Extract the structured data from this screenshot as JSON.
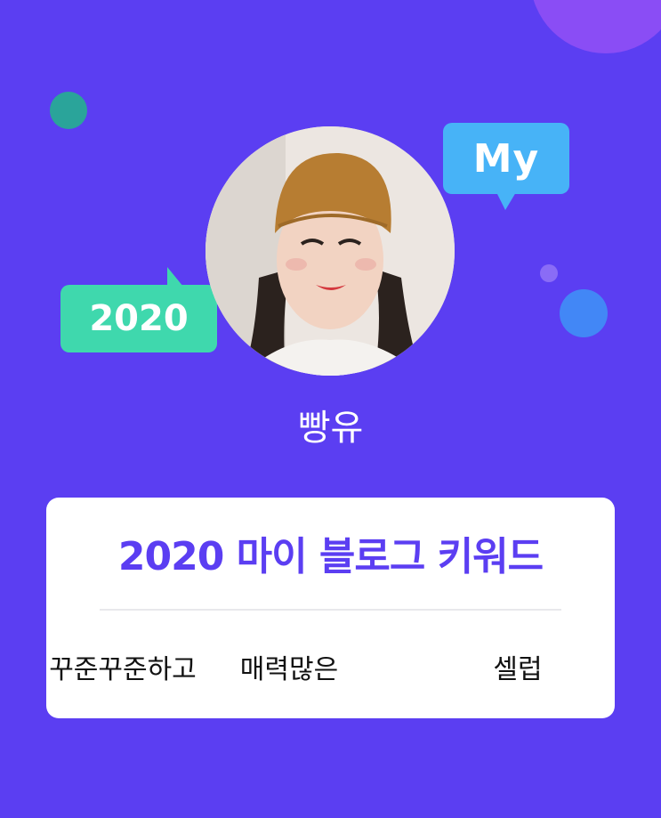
{
  "bubbles": {
    "my": "My",
    "year": "2020"
  },
  "profile": {
    "name": "빵유",
    "avatar": "profile-photo"
  },
  "card": {
    "title": "2020 마이 블로그 키워드",
    "keywords": [
      "꾸준꾸준하고",
      "매력많은",
      "셀럽"
    ]
  },
  "colors": {
    "background": "#5b3ef2",
    "title": "#5b3ef2",
    "my_bubble": "#47b3f7",
    "year_bubble": "#3fd8ad",
    "card": "#ffffff"
  }
}
